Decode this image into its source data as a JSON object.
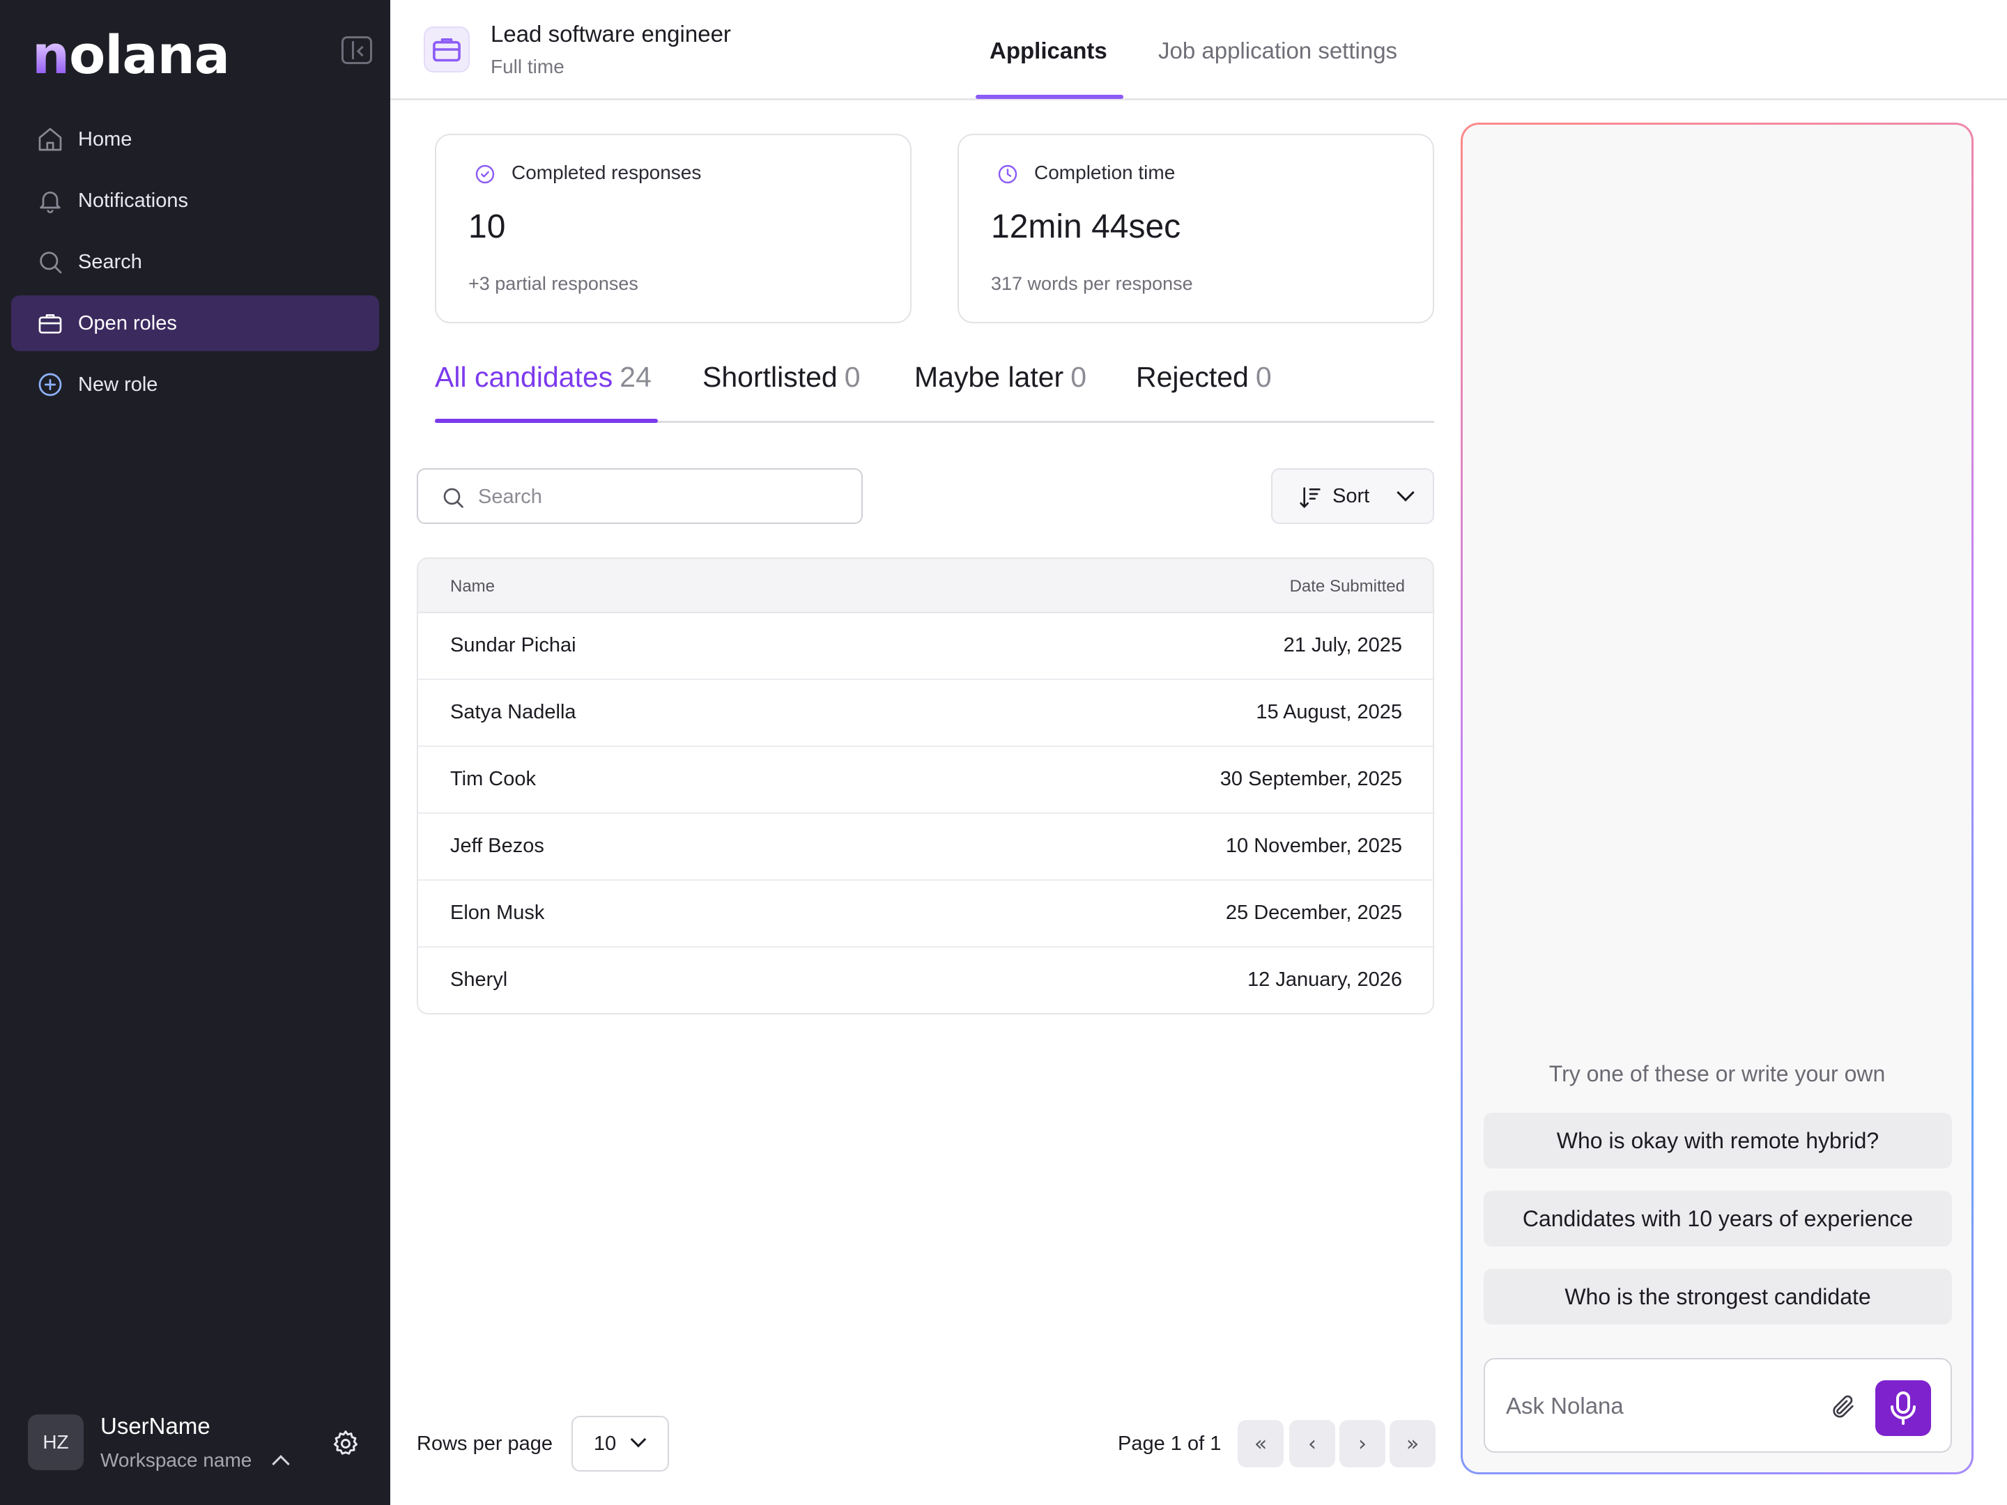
{
  "app": {
    "logo": "nolana"
  },
  "sidebar": {
    "items": [
      {
        "label": "Home",
        "icon": "home-icon"
      },
      {
        "label": "Notifications",
        "icon": "bell-icon"
      },
      {
        "label": "Search",
        "icon": "search-icon"
      },
      {
        "label": "Open roles",
        "icon": "briefcase-icon",
        "active": true
      },
      {
        "label": "New role",
        "icon": "plus-circle-icon"
      }
    ],
    "user": {
      "initials": "HZ",
      "name": "UserName",
      "workspace": "Workspace name"
    }
  },
  "header": {
    "job_title": "Lead software engineer",
    "job_type": "Full time",
    "tabs": [
      {
        "label": "Applicants",
        "active": true
      },
      {
        "label": "Job application settings",
        "active": false
      }
    ]
  },
  "stats": [
    {
      "label": "Completed responses",
      "value": "10",
      "sub": "+3 partial responses",
      "icon": "check-circle-icon"
    },
    {
      "label": "Completion time",
      "value": "12min 44sec",
      "sub": "317 words per response",
      "icon": "clock-icon"
    }
  ],
  "candidate_tabs": [
    {
      "label": "All candidates",
      "count": "24",
      "active": true
    },
    {
      "label": "Shortlisted",
      "count": "0"
    },
    {
      "label": "Maybe later",
      "count": "0"
    },
    {
      "label": "Rejected",
      "count": "0"
    }
  ],
  "search": {
    "placeholder": "Search",
    "value": ""
  },
  "sort": {
    "label": "Sort"
  },
  "table": {
    "columns": [
      "Name",
      "Date Submitted"
    ],
    "rows": [
      {
        "name": "Sundar Pichai",
        "date": "21 July, 2025"
      },
      {
        "name": "Satya Nadella",
        "date": "15 August, 2025"
      },
      {
        "name": "Tim Cook",
        "date": "30 September, 2025"
      },
      {
        "name": "Jeff Bezos",
        "date": "10 November, 2025"
      },
      {
        "name": "Elon Musk",
        "date": "25 December, 2025"
      },
      {
        "name": "Sheryl",
        "date": "12 January, 2026"
      }
    ]
  },
  "pagination": {
    "rows_per_page_label": "Rows per page",
    "rows_per_page": "10",
    "page_label": "Page 1 of 1"
  },
  "assistant": {
    "hint": "Try one of these or write your own",
    "suggestions": [
      "Who is okay with remote hybrid?",
      "Candidates with 10 years of experience",
      "Who is the strongest candidate"
    ],
    "input_placeholder": "Ask Nolana"
  },
  "colors": {
    "accent": "#7c3aed",
    "sidebar_bg": "#1e1f26",
    "sidebar_active": "#3b2a5e",
    "mic_button": "#7e22ce"
  }
}
